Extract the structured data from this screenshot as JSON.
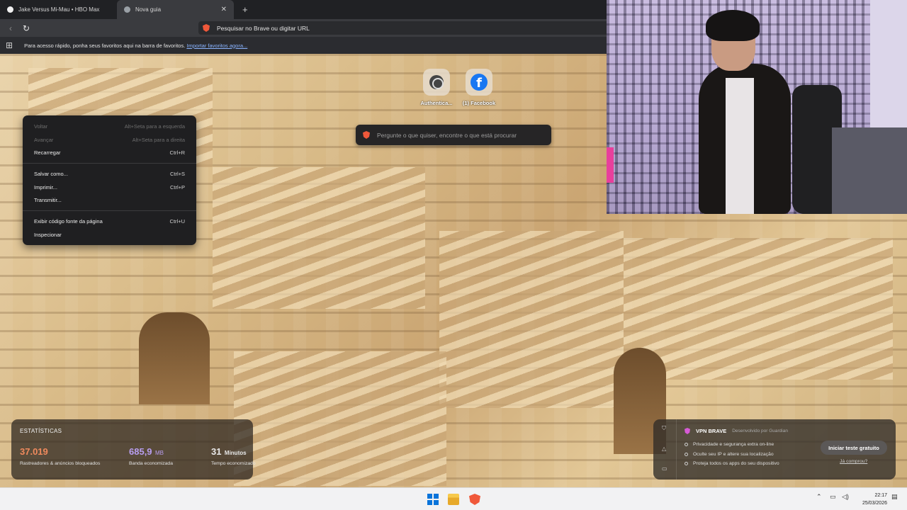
{
  "browser": {
    "tabs": [
      {
        "label": "Jake Versus Mi-Mau • HBO Max",
        "active": false
      },
      {
        "label": "Nova guia",
        "active": true
      }
    ],
    "new_tab_glyph": "+",
    "url_placeholder": "Pesquisar no Brave ou digitar URL",
    "bookmarks_hint": "Para acesso rápido, ponha seus favoritos aqui na barra de favoritos.",
    "import_link": "Importar favoritos agora..."
  },
  "new_tab": {
    "tiles": [
      {
        "label": "Authentica...",
        "icon": "globe-icon"
      },
      {
        "label": "(1) Facebook",
        "icon": "facebook-icon"
      }
    ],
    "ask_placeholder": "Pergunte o que quiser, encontre o que está procurar"
  },
  "context_menu": {
    "groups": [
      [
        {
          "label": "Voltar",
          "shortcut": "Alt+Seta para a esquerda",
          "disabled": true
        },
        {
          "label": "Avançar",
          "shortcut": "Alt+Seta para a direita",
          "disabled": true
        },
        {
          "label": "Recarregar",
          "shortcut": "Ctrl+R",
          "disabled": false
        }
      ],
      [
        {
          "label": "Salvar como...",
          "shortcut": "Ctrl+S",
          "disabled": false
        },
        {
          "label": "Imprimir...",
          "shortcut": "Ctrl+P",
          "disabled": false
        },
        {
          "label": "Transmitir...",
          "shortcut": "",
          "disabled": false
        }
      ],
      [
        {
          "label": "Exibir código fonte da página",
          "shortcut": "Ctrl+U",
          "disabled": false
        },
        {
          "label": "Inspecionar",
          "shortcut": "",
          "disabled": false
        }
      ]
    ]
  },
  "stats": {
    "title": "ESTATÍSTICAS",
    "items": [
      {
        "value": "37.019",
        "unit": "",
        "desc": "Rastreadores & anúncios bloqueados",
        "color": "#f08a5d"
      },
      {
        "value": "685,9",
        "unit": "MB",
        "desc": "Banda economizada",
        "color": "#b89ef0"
      },
      {
        "value": "31",
        "unit": "Minutos",
        "desc": "Tempo economizado",
        "color": "#ffffff"
      }
    ]
  },
  "vpn": {
    "title": "VPN BRAVE",
    "by": "Desenvolvido por Guardian",
    "features": [
      "Privacidade e segurança extra on-line",
      "Oculte seu IP e altere sua localização",
      "Proteja todos os apps do seu dispositivo"
    ],
    "trial_button": "Iniciar teste gratuito",
    "bought_link": "Já comprou?"
  },
  "taskbar": {
    "time": "22:17",
    "date": "25/03/2026"
  }
}
